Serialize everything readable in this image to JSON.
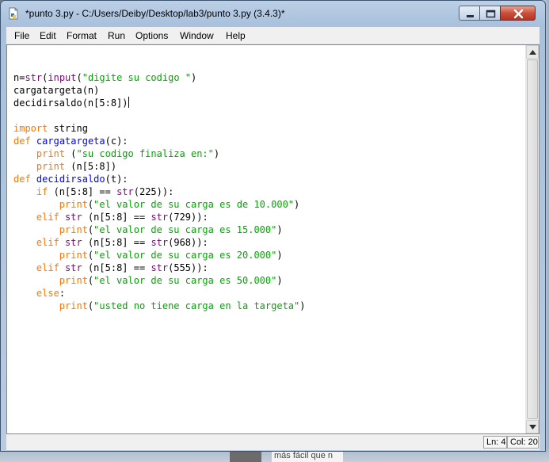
{
  "window": {
    "title": "*punto 3.py - C:/Users/Deiby/Desktop/lab3/punto 3.py (3.4.3)*",
    "icon": "python-file-icon",
    "controls": [
      "minimize-icon",
      "maximize-icon",
      "close-icon"
    ]
  },
  "menu": {
    "items": [
      {
        "label": "File"
      },
      {
        "label": "Edit"
      },
      {
        "label": "Format"
      },
      {
        "label": "Run"
      },
      {
        "label": "Options"
      },
      {
        "label": "Window"
      },
      {
        "label": "Help"
      }
    ]
  },
  "code": {
    "colors": {
      "keyword": "#ff7700",
      "builtin": "#900090",
      "definition": "#0000ff",
      "string": "#00aa00"
    },
    "lines": [
      [],
      [
        [
          "n=",
          ""
        ],
        [
          "str",
          "bi"
        ],
        [
          "(",
          ""
        ],
        [
          "input",
          "bi"
        ],
        [
          "(",
          ""
        ],
        [
          "\"digite su codigo \"",
          "st"
        ],
        [
          ")",
          ""
        ]
      ],
      [
        [
          "cargatargeta(n)",
          ""
        ]
      ],
      [
        [
          "decidirsaldo(n[5:8])",
          ""
        ],
        [
          "",
          "caret"
        ]
      ],
      [],
      [
        [
          "import",
          "kw"
        ],
        [
          " string",
          ""
        ]
      ],
      [
        [
          "def",
          "kw"
        ],
        [
          " ",
          ""
        ],
        [
          "cargatargeta",
          "def"
        ],
        [
          "(c):",
          ""
        ]
      ],
      [
        [
          "    ",
          ""
        ],
        [
          "print",
          "kw"
        ],
        [
          " (",
          ""
        ],
        [
          "\"su codigo finaliza en:\"",
          "st"
        ],
        [
          ")",
          ""
        ]
      ],
      [
        [
          "    ",
          ""
        ],
        [
          "print",
          "kw"
        ],
        [
          " (n[5:8])",
          ""
        ]
      ],
      [
        [
          "def",
          "kw"
        ],
        [
          " ",
          ""
        ],
        [
          "decidirsaldo",
          "def"
        ],
        [
          "(t):",
          ""
        ]
      ],
      [
        [
          "    ",
          ""
        ],
        [
          "if",
          "kw"
        ],
        [
          " (n[5:8] == ",
          ""
        ],
        [
          "str",
          "bi"
        ],
        [
          "(225)):",
          ""
        ]
      ],
      [
        [
          "        ",
          ""
        ],
        [
          "print",
          "kw"
        ],
        [
          "(",
          ""
        ],
        [
          "\"el valor de su carga es de 10.000\"",
          "st"
        ],
        [
          ")",
          ""
        ]
      ],
      [
        [
          "    ",
          ""
        ],
        [
          "elif",
          "kw"
        ],
        [
          " ",
          ""
        ],
        [
          "str",
          "bi"
        ],
        [
          " (n[5:8] == ",
          ""
        ],
        [
          "str",
          "bi"
        ],
        [
          "(729)):",
          ""
        ]
      ],
      [
        [
          "        ",
          ""
        ],
        [
          "print",
          "kw"
        ],
        [
          "(",
          ""
        ],
        [
          "\"el valor de su carga es 15.000\"",
          "st"
        ],
        [
          ")",
          ""
        ]
      ],
      [
        [
          "    ",
          ""
        ],
        [
          "elif",
          "kw"
        ],
        [
          " ",
          ""
        ],
        [
          "str",
          "bi"
        ],
        [
          " (n[5:8] == ",
          ""
        ],
        [
          "str",
          "bi"
        ],
        [
          "(968)):",
          ""
        ]
      ],
      [
        [
          "        ",
          ""
        ],
        [
          "print",
          "kw"
        ],
        [
          "(",
          ""
        ],
        [
          "\"el valor de su carga es 20.000\"",
          "st"
        ],
        [
          ")",
          ""
        ]
      ],
      [
        [
          "    ",
          ""
        ],
        [
          "elif",
          "kw"
        ],
        [
          " ",
          ""
        ],
        [
          "str",
          "bi"
        ],
        [
          " (n[5:8] == ",
          ""
        ],
        [
          "str",
          "bi"
        ],
        [
          "(555)):",
          ""
        ]
      ],
      [
        [
          "        ",
          ""
        ],
        [
          "print",
          "kw"
        ],
        [
          "(",
          ""
        ],
        [
          "\"el valor de su carga es 50.000\"",
          "st"
        ],
        [
          ")",
          ""
        ]
      ],
      [
        [
          "    ",
          ""
        ],
        [
          "else",
          "kw"
        ],
        [
          ":",
          ""
        ]
      ],
      [
        [
          "        ",
          ""
        ],
        [
          "print",
          "kw"
        ],
        [
          "(",
          ""
        ],
        [
          "\"usted no tiene carga en la targeta\"",
          "st"
        ],
        [
          ")",
          ""
        ]
      ]
    ]
  },
  "status": {
    "line": "Ln: 4",
    "column": "Col: 20"
  },
  "background": {
    "text": "más fácil que n"
  }
}
